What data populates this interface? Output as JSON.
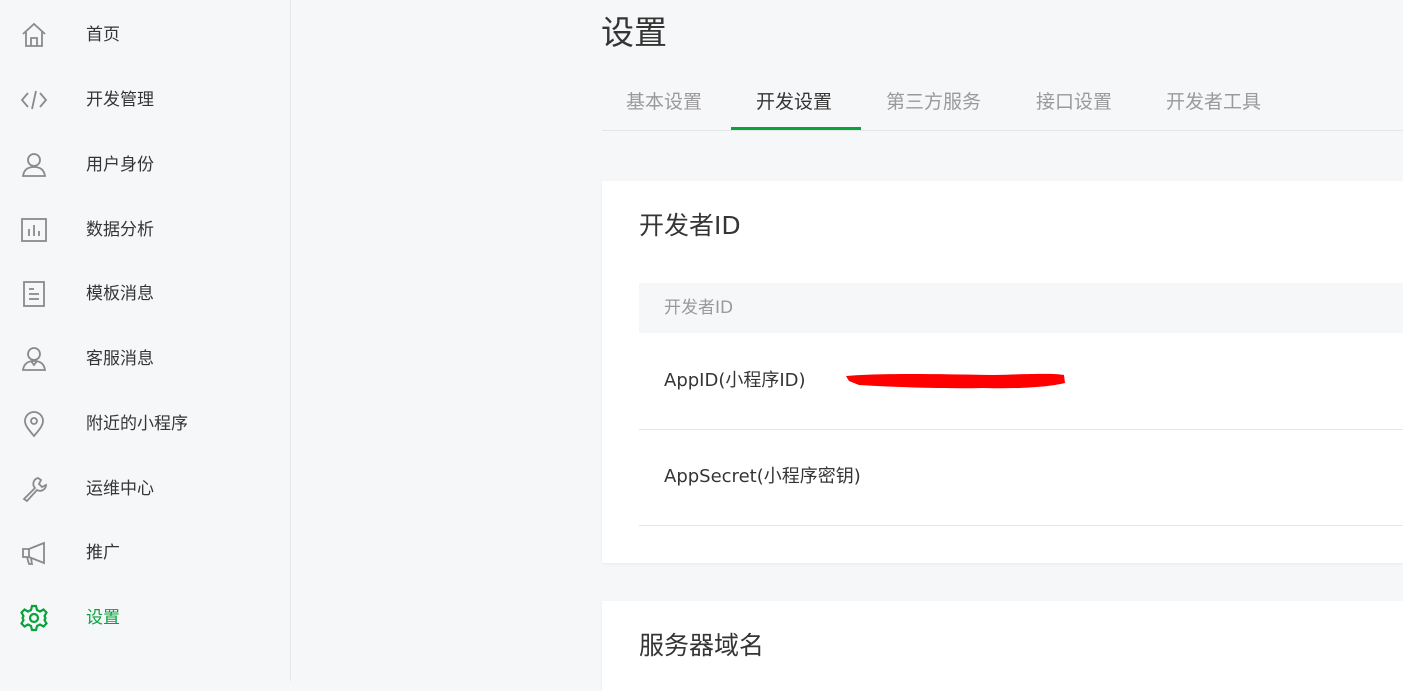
{
  "sidebar": {
    "items": [
      {
        "label": "首页",
        "icon": "home-icon"
      },
      {
        "label": "开发管理",
        "icon": "code-icon"
      },
      {
        "label": "用户身份",
        "icon": "user-icon"
      },
      {
        "label": "数据分析",
        "icon": "chart-icon"
      },
      {
        "label": "模板消息",
        "icon": "document-icon"
      },
      {
        "label": "客服消息",
        "icon": "support-user-icon"
      },
      {
        "label": "附近的小程序",
        "icon": "location-pin-icon"
      },
      {
        "label": "运维中心",
        "icon": "wrench-icon"
      },
      {
        "label": "推广",
        "icon": "megaphone-icon"
      },
      {
        "label": "设置",
        "icon": "gear-icon",
        "active": true
      }
    ]
  },
  "main": {
    "title": "设置",
    "tabs": [
      {
        "label": "基本设置"
      },
      {
        "label": "开发设置",
        "active": true
      },
      {
        "label": "第三方服务"
      },
      {
        "label": "接口设置"
      },
      {
        "label": "开发者工具"
      }
    ],
    "developer_card": {
      "title": "开发者ID",
      "table_header": "开发者ID",
      "rows": [
        {
          "label": "AppID(小程序ID)"
        },
        {
          "label": "AppSecret(小程序密钥)"
        }
      ]
    },
    "server_card": {
      "title": "服务器域名"
    }
  },
  "colors": {
    "accent": "#07a33b",
    "redaction": "#ff0000",
    "background": "#f6f7f9",
    "text": "#353535",
    "muted_text": "#9a9a9a"
  }
}
